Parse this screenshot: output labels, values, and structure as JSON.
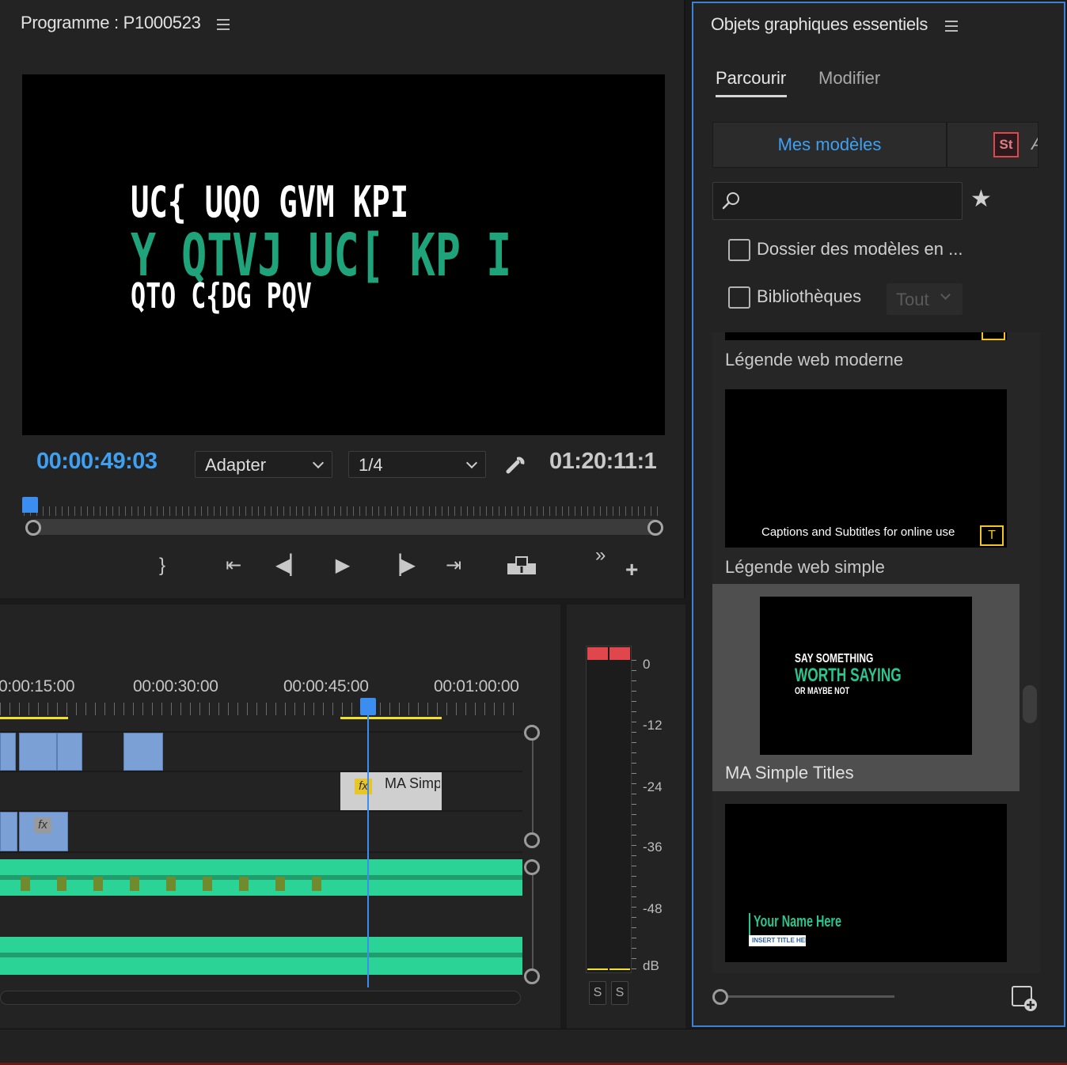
{
  "program": {
    "title": "Programme : P1000523",
    "video_text": {
      "line1": "UC{ UQO GVM KPI",
      "line2": "Y QTVJ UC[ KP I",
      "line3": "QTO C{DG PQV"
    },
    "timecode_current": "00:00:49:03",
    "fit_label": "Adapter",
    "resolution_label": "1/4",
    "timecode_duration": "01:20:11:1"
  },
  "timeline": {
    "ruler": [
      "0:00:15:00",
      "00:00:30:00",
      "00:00:45:00",
      "00:01:00:00"
    ],
    "clip_title": "MA Simp",
    "fx_label": "fx"
  },
  "meter": {
    "db_labels": [
      "0",
      "-12",
      "-24",
      "-36",
      "-48",
      "dB"
    ],
    "solo_labels": [
      "S",
      "S"
    ]
  },
  "essential_graphics": {
    "title": "Objets graphiques essentiels",
    "tabs": [
      "Parcourir",
      "Modifier"
    ],
    "active_tab": "Parcourir",
    "source_tab_label": "Mes modèles",
    "stock_badge": "St",
    "stock_cut_label": "A",
    "search": {
      "value": "",
      "placeholder": ""
    },
    "checkbox_folder": "Dossier des modèles en ...",
    "checkbox_libraries": "Bibliothèques",
    "libraries_select": "Tout",
    "templates": [
      {
        "name": "Légende web moderne",
        "caption": "Captions and Subtitles for online use"
      },
      {
        "name": "Légende web simple",
        "line1": "SAY SOMETHING",
        "line2": "WORTH SAYING",
        "line3": "OR MAYBE NOT",
        "title": "MA Simple Titles"
      },
      {
        "name": "",
        "line1": "Your Name Here",
        "line2": "INSERT TITLE HERE"
      }
    ]
  },
  "colors": {
    "accent_blue": "#3fa0f2",
    "video_green": "#1fa37a",
    "audio_green": "#2bd496",
    "meter_red": "#e0474c",
    "warning_yellow": "#f3c522"
  }
}
